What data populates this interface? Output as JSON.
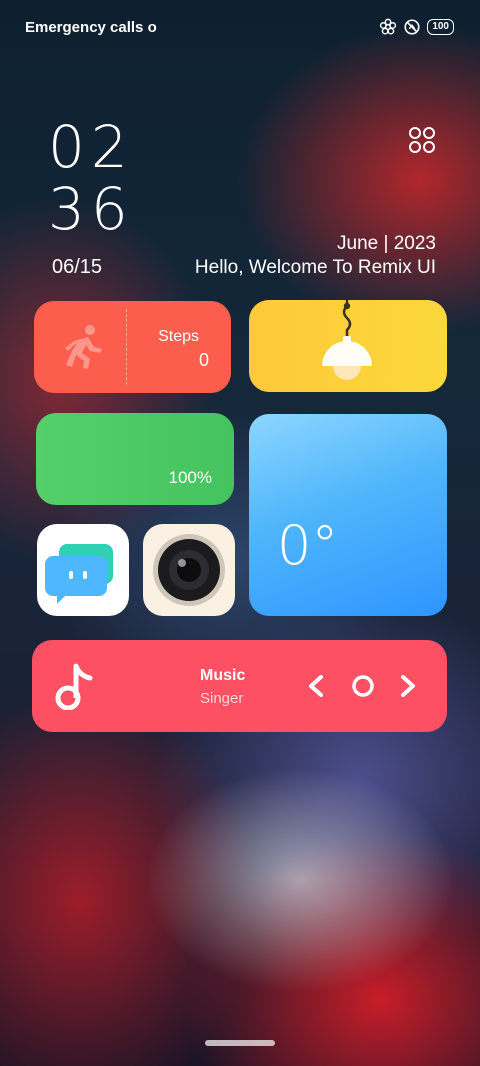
{
  "status_bar": {
    "carrier": "Emergency calls o",
    "battery": "100"
  },
  "lockscreen": {
    "hour": "02",
    "minute": "36",
    "date_short": "06/15",
    "month_year": "June | 2023",
    "greeting": "Hello, Welcome To Remix UI"
  },
  "widgets": {
    "steps": {
      "label": "Steps",
      "value": "0"
    },
    "battery": {
      "value": "100%"
    },
    "weather": {
      "temperature": "0°"
    },
    "music": {
      "title": "Music",
      "singer": "Singer"
    }
  },
  "icons": {
    "grid": "apps-grid-icon",
    "steps": "running-person-icon",
    "lamp": "lamp-icon",
    "chat": "chat-app-icon",
    "camera": "camera-app-icon",
    "music_note": "music-note-icon",
    "prev": "chevron-left-icon",
    "play": "play-circle-icon",
    "next": "chevron-right-icon"
  },
  "colors": {
    "steps_bg": "#fb5e4d",
    "lamp_bg": "#fbd83b",
    "battery_bg": "#4ccb65",
    "weather_bg": "#4fb5fb",
    "music_bg": "#fd5063"
  }
}
